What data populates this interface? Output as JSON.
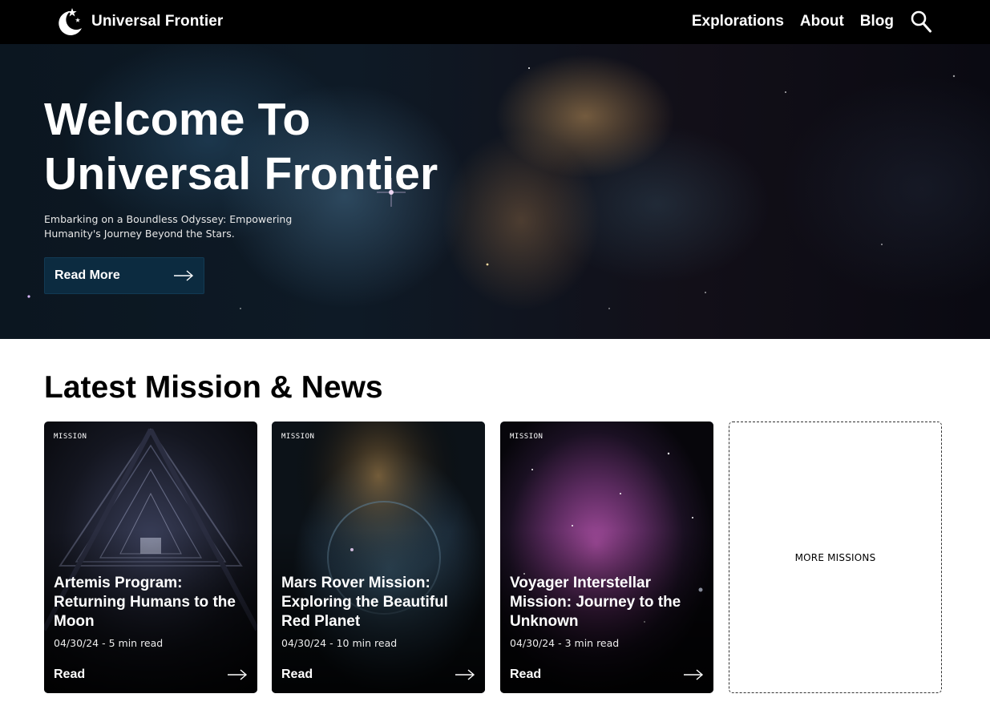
{
  "header": {
    "brand": "Universal Frontier",
    "nav": [
      "Explorations",
      "About",
      "Blog"
    ]
  },
  "hero": {
    "title_line1": "Welcome To",
    "title_line2": "Universal Frontier",
    "subtitle_line1": "Embarking on a Boundless Odyssey: Empowering",
    "subtitle_line2": "Humanity's Journey Beyond the Stars.",
    "cta": "Read More"
  },
  "section": {
    "title": "Latest Mission & News"
  },
  "cards": [
    {
      "tag": "MISSION",
      "title_lines": [
        "Artemis Program:",
        "Returning Humans to the",
        "Moon"
      ],
      "meta": "04/30/24 - 5 min read",
      "read": "Read"
    },
    {
      "tag": "MISSION",
      "title_lines": [
        "Mars Rover Mission:",
        "Exploring the Beautiful",
        "Red Planet"
      ],
      "meta": "04/30/24 - 10 min read",
      "read": "Read"
    },
    {
      "tag": "MISSION",
      "title_lines": [
        "Voyager Interstellar",
        "Mission: Journey to the",
        "Unknown"
      ],
      "meta": "04/30/24 - 3 min read",
      "read": "Read"
    }
  ],
  "more": {
    "label": "MORE MISSIONS"
  },
  "colors": {
    "header_bg": "#000000",
    "cta_bg": "#0c2b40",
    "text_light": "#ffffff",
    "text_dark": "#000000"
  },
  "icons": {
    "logo": "moon-star-logo-icon",
    "search": "search-icon",
    "arrow": "arrow-right-icon"
  }
}
